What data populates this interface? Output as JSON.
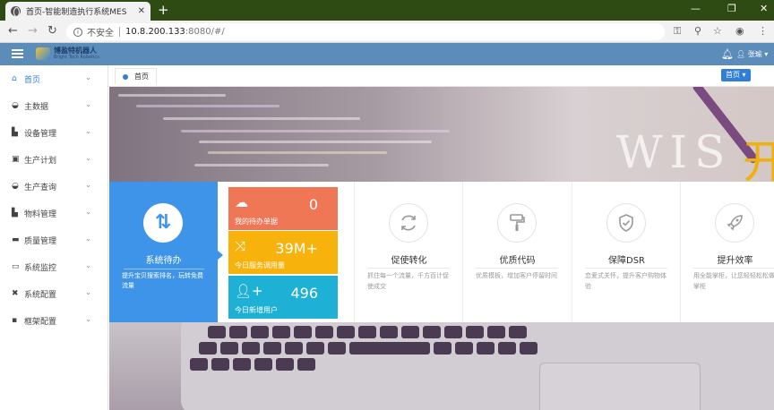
{
  "browser": {
    "tab_title": "首页-智能制造执行系统MES",
    "tab_close": "✕",
    "new_tab": "+",
    "win_min": "—",
    "win_restore": "❐",
    "win_close": "✕",
    "security_label": "不安全",
    "url_host": "10.8.200.133",
    "url_path": ":8080/#/"
  },
  "header": {
    "logo_text": "博盈特机器人",
    "logo_sub": "Bright Tech Robotics",
    "user_name": "张瑜"
  },
  "sidebar": {
    "items": [
      {
        "label": "首页",
        "icon": "home-icon",
        "glyph": "⌂"
      },
      {
        "label": "主数据",
        "icon": "pie-icon",
        "glyph": "◒"
      },
      {
        "label": "设备管理",
        "icon": "cart-icon",
        "glyph": "🛒"
      },
      {
        "label": "生产计划",
        "icon": "car-icon",
        "glyph": "▣"
      },
      {
        "label": "生产查询",
        "icon": "pie-icon",
        "glyph": "◒"
      },
      {
        "label": "物料管理",
        "icon": "cart-icon",
        "glyph": "🛒"
      },
      {
        "label": "质量管理",
        "icon": "folder-icon",
        "glyph": "▬"
      },
      {
        "label": "系统监控",
        "icon": "monitor-icon",
        "glyph": "▭"
      },
      {
        "label": "系统配置",
        "icon": "tools-icon",
        "glyph": "✖"
      },
      {
        "label": "框架配置",
        "icon": "layout-icon",
        "glyph": "▪"
      }
    ]
  },
  "tabs": {
    "active_tab": "首页",
    "home_dropdown": "首页 ▾"
  },
  "banner": {
    "word": "WIS",
    "accent_char": "开"
  },
  "dashboard": {
    "todo": {
      "title": "系统待办",
      "desc": "提升宝贝搜索排名，玩转免费流量"
    },
    "stats": [
      {
        "value": "0",
        "label": "我的待办单据",
        "icon": "cloud-upload-icon"
      },
      {
        "value": "39M+",
        "label": "今日服务调用量",
        "icon": "shuffle-icon"
      },
      {
        "value": "496",
        "label": "今日新增用户",
        "icon": "user-add-icon"
      }
    ],
    "features": [
      {
        "title": "促使转化",
        "desc": "抓住每一个流量，千方百计促使成交",
        "icon": "refresh-icon"
      },
      {
        "title": "优质代码",
        "desc": "优质模板，增加客户停留时间",
        "icon": "paint-roller-icon"
      },
      {
        "title": "保障DSR",
        "desc": "恋爱式关怀，提升客户购物体验",
        "icon": "shield-check-icon"
      },
      {
        "title": "提升效率",
        "desc": "用全能掌柜，让您轻轻松松做掌柜",
        "icon": "rocket-icon"
      }
    ]
  }
}
